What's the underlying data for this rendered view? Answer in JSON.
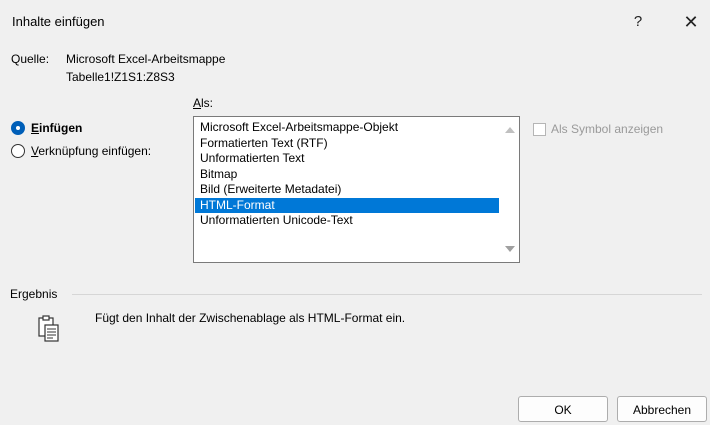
{
  "window": {
    "title": "Inhalte einfügen",
    "help_glyph": "?",
    "close_glyph": "✕"
  },
  "source": {
    "label": "Quelle:",
    "app": "Microsoft Excel-Arbeitsmappe",
    "range": "Tabelle1!Z1S1:Z8S3"
  },
  "as_label": {
    "access_key": "A",
    "rest": "ls:"
  },
  "paste_options": [
    {
      "access_key": "E",
      "rest": "infügen",
      "checked": true
    },
    {
      "access_key": "V",
      "rest": "erknüpfung einfügen:",
      "checked": false
    }
  ],
  "formats": {
    "items": [
      "Microsoft Excel-Arbeitsmappe-Objekt",
      "Formatierten Text (RTF)",
      "Unformatierten Text",
      "Bitmap",
      "Bild (Erweiterte Metadatei)",
      "HTML-Format",
      "Unformatierten Unicode-Text"
    ],
    "selected": "HTML-Format"
  },
  "symbol_checkbox": {
    "label": "Als Symbol anzeigen",
    "checked": false,
    "enabled": false
  },
  "result": {
    "label": "Ergebnis",
    "text": "Fügt den Inhalt der Zwischenablage als HTML-Format ein.",
    "icon": "clipboard-document-icon"
  },
  "buttons": {
    "ok": "OK",
    "cancel": "Abbrechen"
  },
  "colors": {
    "selection": "#0078d7",
    "radio_accent": "#005fb8",
    "background": "#f0f0f0"
  }
}
